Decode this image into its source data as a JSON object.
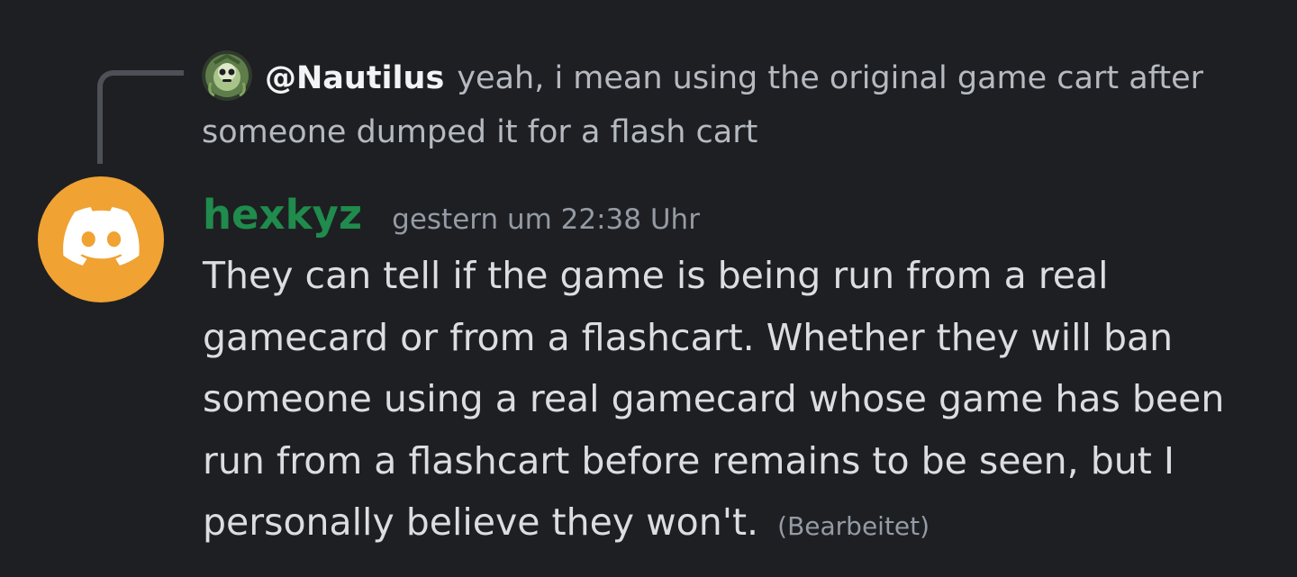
{
  "reply": {
    "author": "@Nautilus",
    "text": "yeah, i mean using the original game cart after someone dumped it for a flash cart"
  },
  "message": {
    "author": "hexkyz",
    "author_color": "#1f8b4c",
    "timestamp": "gestern um 22:38 Uhr",
    "content": "They can tell if the game is being run from a real gamecard or from a flashcart. Whether they will ban someone using a real gamecard whose game has been run from a flashcart before remains to be seen, but I personally believe they won't.",
    "edited_label": "(Bearbeitet)",
    "avatar_icon": "discord-logo-icon",
    "avatar_color": "#f0a232"
  }
}
